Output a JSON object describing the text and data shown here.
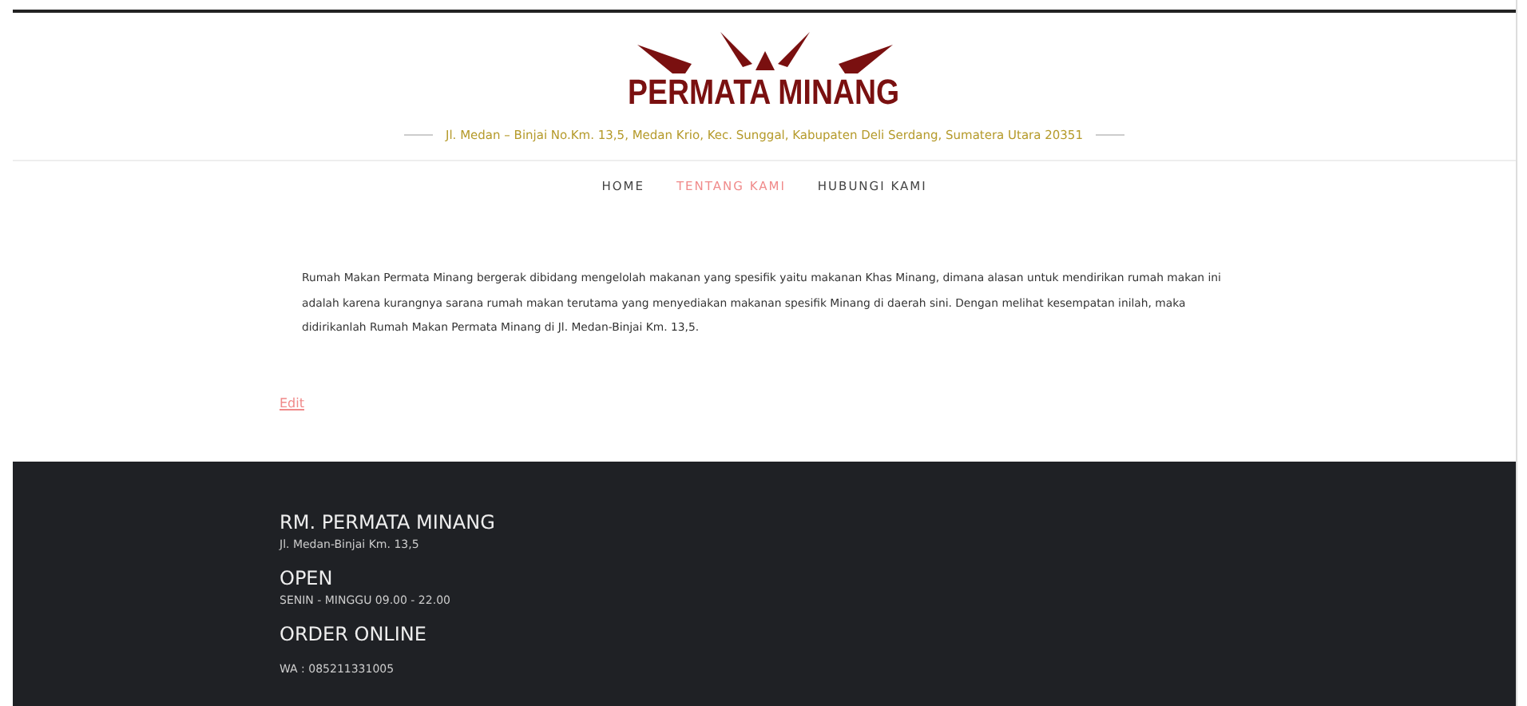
{
  "header": {
    "logo_text": "PERMATA MINANG",
    "address": "Jl. Medan – Binjai No.Km. 13,5, Medan Krio, Kec. Sunggal, Kabupaten Deli Serdang, Sumatera Utara 20351"
  },
  "nav": [
    {
      "label": "HOME",
      "selected": false
    },
    {
      "label": "TENTANG KAMI",
      "selected": true
    },
    {
      "label": "HUBUNGI KAMI",
      "selected": false
    }
  ],
  "content": {
    "paragraph": "Rumah Makan Permata Minang bergerak dibidang mengelolah makanan yang spesifik yaitu makanan Khas Minang, dimana alasan untuk mendirikan rumah makan ini adalah karena kurangnya sarana rumah makan terutama yang menyediakan makanan spesifik Minang di daerah sini. Dengan melihat kesempatan inilah, maka didirikanlah Rumah Makan Permata Minang di Jl. Medan-Binjai Km. 13,5.",
    "edit_link": "Edit"
  },
  "footer": [
    {
      "heading": "RM. PERMATA MINANG",
      "text": "Jl. Medan-Binjai Km. 13,5"
    },
    {
      "heading": "OPEN",
      "text": "SENIN - MINGGU 09.00 - 22.00"
    },
    {
      "heading": "ORDER ONLINE",
      "text": "WA : 085211331005"
    }
  ]
}
